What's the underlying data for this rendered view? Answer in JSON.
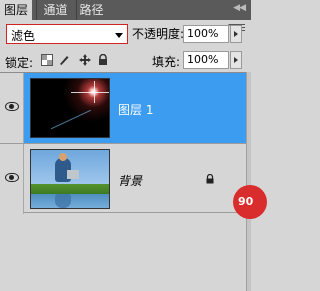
{
  "tabs": [
    {
      "label": "图层",
      "active": true
    },
    {
      "label": "通道",
      "active": false
    },
    {
      "label": "路径",
      "active": false
    }
  ],
  "collapse_glyph": "◀◀",
  "blend_mode": {
    "selected": "滤色"
  },
  "opacity": {
    "label": "不透明度:",
    "value": "100%"
  },
  "lock": {
    "label": "锁定:"
  },
  "fill": {
    "label": "填充:",
    "value": "100%"
  },
  "layers": [
    {
      "name": "图层 1",
      "visible": true,
      "selected": true,
      "locked": false,
      "thumbnail": "lens-flare"
    },
    {
      "name": "背景",
      "visible": true,
      "selected": false,
      "locked": true,
      "thumbnail": "boy-with-laptop"
    }
  ],
  "badge": {
    "text": "90",
    "color": "#d92c2c"
  },
  "colors": {
    "selected_row": "#3c9cf0",
    "blend_border": "#d02424"
  }
}
